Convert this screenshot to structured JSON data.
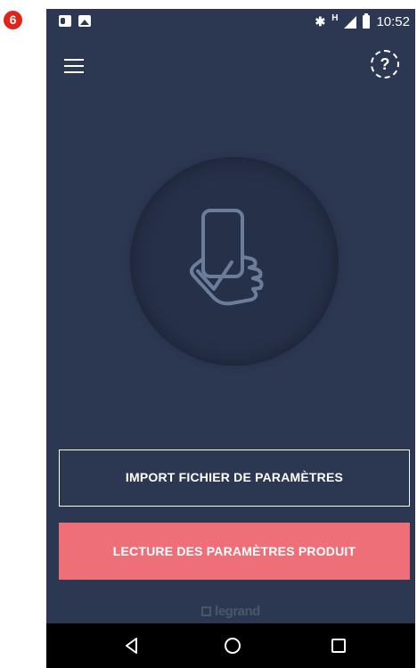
{
  "step_badge": "❻",
  "status_bar": {
    "left_icons": [
      "outlook-icon",
      "photo-icon"
    ],
    "right_icons": [
      "bluetooth-icon",
      "network-type-icon",
      "signal-icon",
      "battery-icon"
    ],
    "network_type": "H",
    "time": "10:52"
  },
  "header": {
    "menu_icon": "hamburger-menu-icon",
    "help_icon": "help-icon",
    "help_glyph": "?"
  },
  "hero": {
    "icon": "hand-holding-phone-icon"
  },
  "buttons": {
    "import_label": "IMPORT FICHIER DE PARAMÈTRES",
    "read_label": "LECTURE DES PARAMÈTRES PRODUIT"
  },
  "brand": {
    "logo_text": "legrand"
  },
  "nav_bar": {
    "back_icon": "back-triangle-icon",
    "home_icon": "home-circle-icon",
    "recent_icon": "recent-apps-square-icon"
  },
  "colors": {
    "background": "#2c3752",
    "circle": "#263048",
    "primary_button": "#ef6f78",
    "badge": "#e2231a"
  }
}
